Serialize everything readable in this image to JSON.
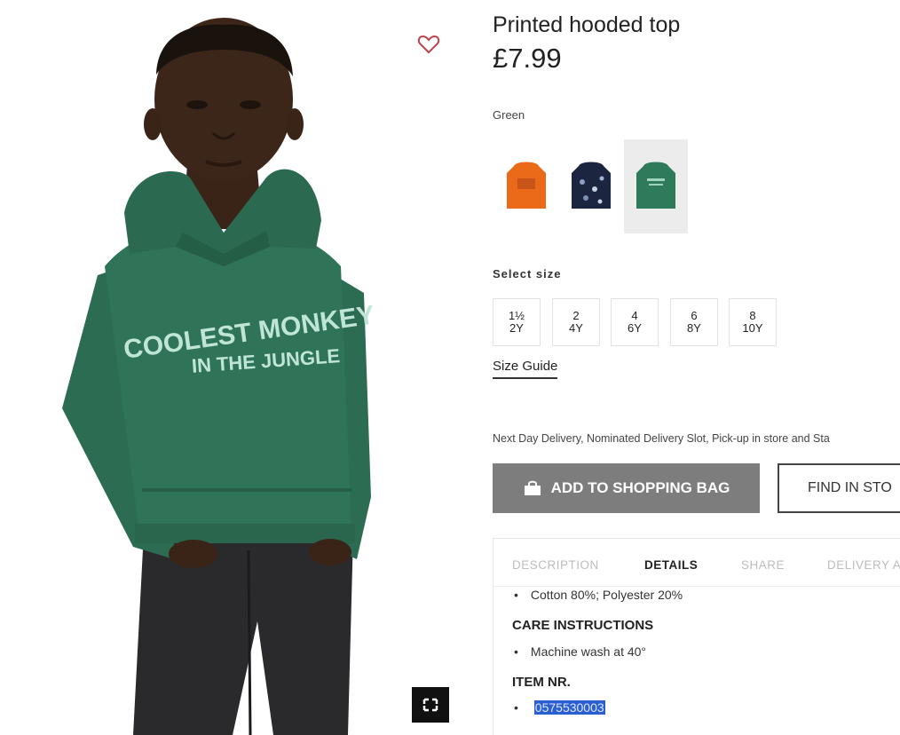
{
  "product": {
    "title": "Printed hooded top",
    "price": "£7.99",
    "color_selected": "Green",
    "swatches": [
      {
        "name": "orange",
        "color": "#ea6a1a"
      },
      {
        "name": "navy-print",
        "color": "#1c2540"
      },
      {
        "name": "green",
        "color": "#2e7a5a"
      }
    ],
    "hoodie_print": [
      "COOLEST MONKEY",
      "IN THE JUNGLE"
    ]
  },
  "sizes": {
    "label": "Select size",
    "options": [
      {
        "top": "1½",
        "bottom": "2Y"
      },
      {
        "top": "2",
        "bottom": "4Y"
      },
      {
        "top": "4",
        "bottom": "6Y"
      },
      {
        "top": "6",
        "bottom": "8Y"
      },
      {
        "top": "8",
        "bottom": "10Y"
      }
    ],
    "guide": "Size Guide"
  },
  "delivery_text": "Next Day Delivery, Nominated Delivery Slot, Pick-up in store and Sta",
  "actions": {
    "add_to_bag": "ADD TO SHOPPING BAG",
    "find_in_store": "FIND IN STO"
  },
  "tabs": [
    "DESCRIPTION",
    "DETAILS",
    "SHARE",
    "DELIVERY A"
  ],
  "active_tab": "DETAILS",
  "details": {
    "composition": "Cotton 80%; Polyester 20%",
    "care_heading": "CARE INSTRUCTIONS",
    "care": "Machine wash at 40°",
    "item_heading": "ITEM NR.",
    "item_number": "0575530003"
  },
  "colors": {
    "hoodie": "#2f7358",
    "button_grey": "#7d7d7d",
    "selection_blue": "#2a5fd1"
  }
}
